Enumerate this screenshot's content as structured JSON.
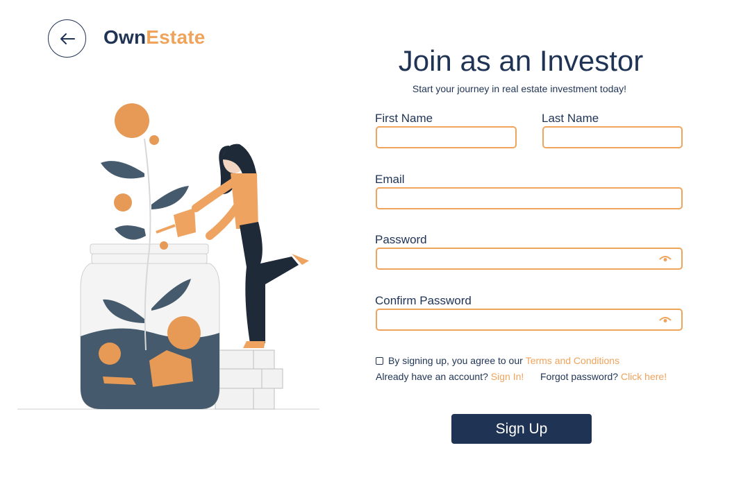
{
  "header": {
    "logo_part1": "Own",
    "logo_part2": "Estate",
    "back_icon": "arrow-left-icon"
  },
  "form": {
    "title": "Join as an Investor",
    "subtitle": "Start your journey in real estate investment today!",
    "first_name_label": "First Name",
    "last_name_label": "Last Name",
    "email_label": "Email",
    "password_label": "Password",
    "confirm_password_label": "Confirm Password",
    "terms_text": "By signing up, you agree to our",
    "terms_link": "Terms and Conditions",
    "account_text": "Already have an account?",
    "sign_in_link": "Sign In!",
    "forgot_text": "Forgot password?",
    "forgot_link": "Click here!",
    "submit_label": "Sign Up"
  },
  "colors": {
    "navy": "#1f3354",
    "accent": "#f0a35b"
  }
}
